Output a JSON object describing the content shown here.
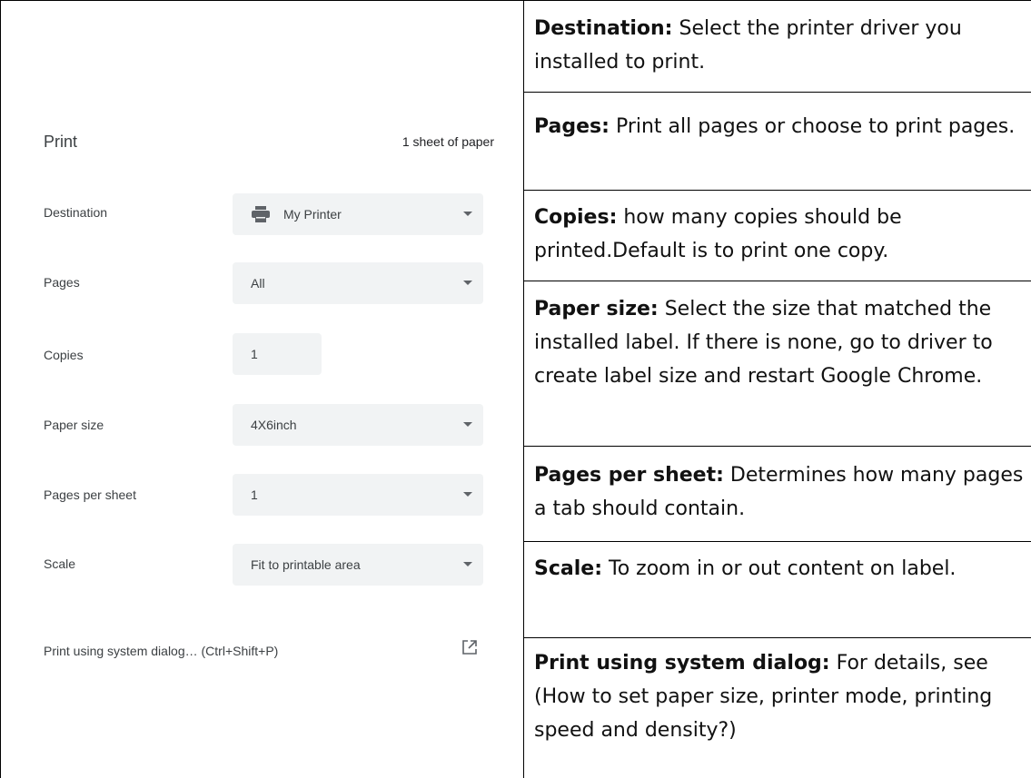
{
  "dialog": {
    "title": "Print",
    "sheet_count": "1 sheet of paper",
    "rows": [
      {
        "label": "Destination",
        "value": "My Printer",
        "icon": "printer-icon",
        "kind": "select"
      },
      {
        "label": "Pages",
        "value": "All",
        "kind": "select"
      },
      {
        "label": "Copies",
        "value": "1",
        "kind": "input"
      },
      {
        "label": "Paper size",
        "value": "4X6inch",
        "kind": "select"
      },
      {
        "label": "Pages per sheet",
        "value": "1",
        "kind": "select"
      },
      {
        "label": "Scale",
        "value": "Fit to printable area",
        "kind": "select"
      }
    ],
    "system_dialog": "Print using system dialog… (Ctrl+Shift+P)",
    "system_dialog_icon": "open-in-new-icon"
  },
  "descriptions": [
    {
      "term": "Destination:",
      "text": " Select the printer driver you installed to print."
    },
    {
      "term": "Pages:",
      "text": " Print all pages or choose to print pages."
    },
    {
      "term": "Copies:",
      "text": " how many copies should be printed.Default is to print one copy."
    },
    {
      "term": "Paper size:",
      "text": " Select the size that matched the installed label. If there is none, go to driver to create label size and restart Google Chrome."
    },
    {
      "term": "Pages per sheet:",
      "text": " Determines how many pages a tab should contain."
    },
    {
      "term": "Scale:",
      "text": " To zoom in or out content on label."
    },
    {
      "term": "Print using system dialog:",
      "text": " For details, see (How to set paper size, printer mode, printing speed and density?)"
    }
  ]
}
